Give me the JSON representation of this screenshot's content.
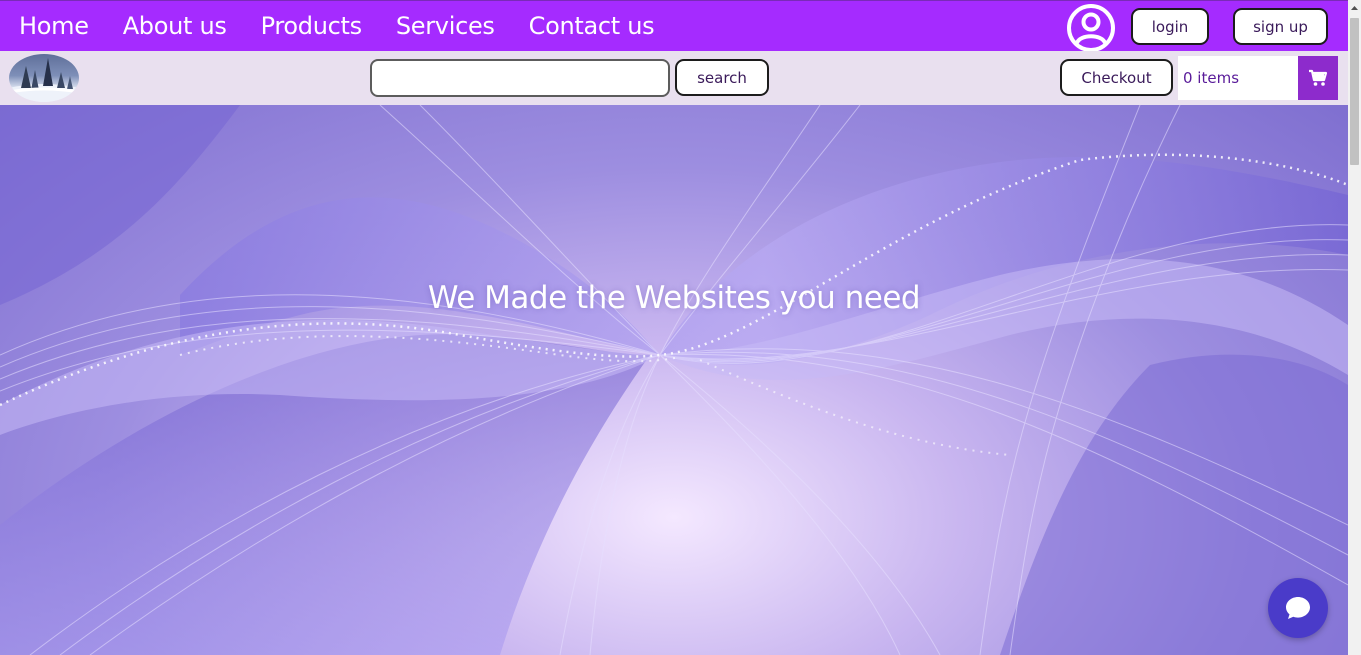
{
  "nav": {
    "links": [
      "Home",
      "About us",
      "Products",
      "Services",
      "Contact us"
    ],
    "login_label": "login",
    "signup_label": "sign up"
  },
  "toolbar": {
    "search_placeholder": "",
    "search_label": "search",
    "checkout_label": "Checkout",
    "cart_count": "0 items"
  },
  "hero": {
    "title": "We Made the Websites you need"
  },
  "icons": {
    "user": "user-circle-icon",
    "cart": "shopping-cart-icon",
    "chat": "chat-bubble-icon",
    "logo": "snowy-trees-logo"
  },
  "colors": {
    "nav_bg": "#a52bff",
    "subbar_bg": "#e9e0ef",
    "cart_btn": "#8d2bcc",
    "chat_btn": "#4a3bc9"
  }
}
